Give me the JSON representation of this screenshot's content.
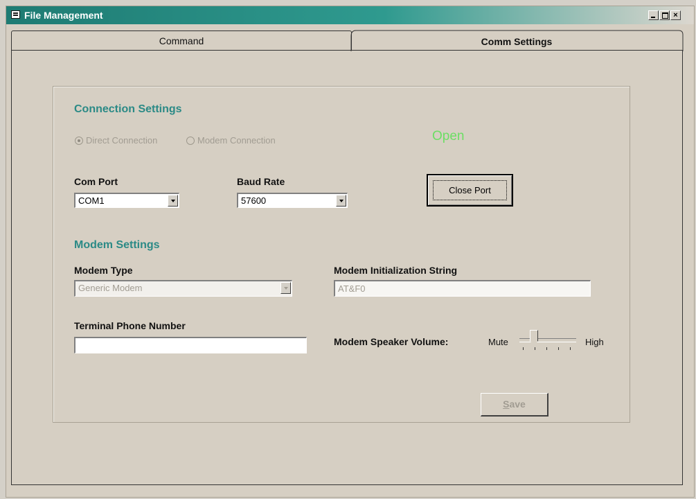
{
  "window": {
    "title": "File Management",
    "controls": {
      "minimize": "_",
      "maximize": "□",
      "close": "×"
    }
  },
  "tabs": [
    {
      "label": "Command",
      "selected": false
    },
    {
      "label": "Comm Settings",
      "selected": true
    }
  ],
  "connection": {
    "heading": "Connection Settings",
    "direct_label": "Direct Connection",
    "modem_label": "Modem Connection",
    "selected": "direct",
    "status": "Open",
    "status_color": "#6cde64"
  },
  "com_port": {
    "label": "Com Port",
    "value": "COM1"
  },
  "baud_rate": {
    "label": "Baud Rate",
    "value": "57600"
  },
  "close_port_label": "Close Port",
  "modem": {
    "heading": "Modem Settings",
    "type_label": "Modem Type",
    "type_value": "Generic Modem",
    "init_label": "Modem Initialization String",
    "init_value": "AT&F0",
    "phone_label": "Terminal Phone Number",
    "phone_value": "",
    "volume_label": "Modem Speaker Volume:",
    "volume_min_label": "Mute",
    "volume_max_label": "High",
    "volume_level": 0.25
  },
  "save": {
    "label_prefix": "",
    "label_mnemonic": "S",
    "label_rest": "ave"
  },
  "colors": {
    "accent_heading": "#2b8a86",
    "title_bar": "#1e7b73"
  }
}
